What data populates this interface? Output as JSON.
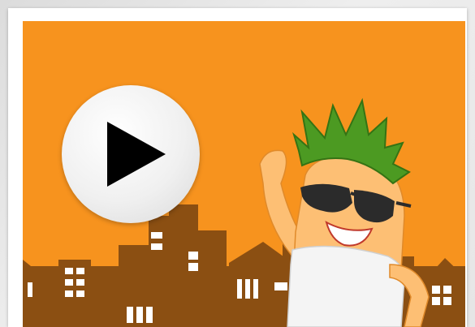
{
  "video_player": {
    "accent_color": "#f7931e",
    "play_icon": "play-icon",
    "mascot": "mascot-character-with-sunglasses",
    "background": "city-skyline"
  }
}
